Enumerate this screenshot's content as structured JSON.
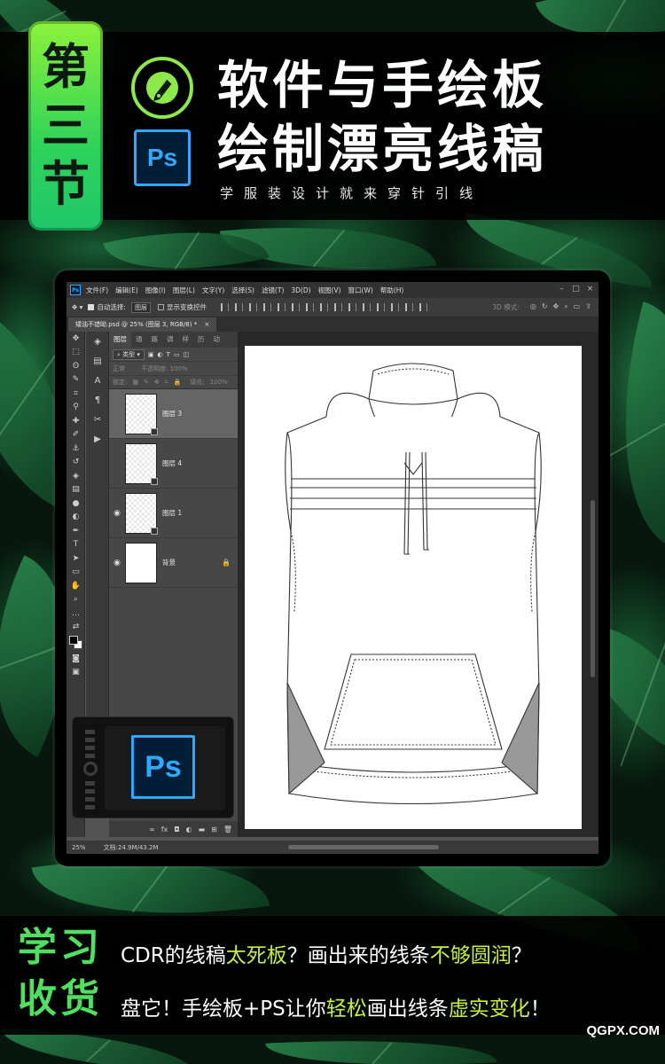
{
  "colors": {
    "accent_green": "#4fe05f",
    "highlight_yellow": "#c6f03a",
    "ps_blue": "#31a8ff",
    "ps_dark": "#001e36"
  },
  "badge": {
    "chars": [
      "第",
      "三",
      "节"
    ]
  },
  "header": {
    "title_line1": "软件与手绘板",
    "title_line2": "绘制漂亮线稿",
    "subtitle": "学服装设计就来穿针引线",
    "cdr_icon": "coreldraw-pen-icon",
    "ps_logo": "Ps"
  },
  "ps": {
    "menu": [
      "文件(F)",
      "编辑(E)",
      "图像(I)",
      "图层(L)",
      "文字(Y)",
      "选择(S)",
      "滤镜(T)",
      "3D(D)",
      "视图(V)",
      "窗口(W)",
      "帮助(H)"
    ],
    "options": {
      "auto_select": "自动选择:",
      "auto_select_value": "图层",
      "show_transform": "显示变换控件",
      "mode_3d": "3D 模式:"
    },
    "doc_tab": "矮油不错呦.psd @ 25% (图层 3, RGB/8) *",
    "panel_tabs": [
      "图层",
      "通",
      "路",
      "调",
      "样",
      "历",
      "动"
    ],
    "filter_label": "类型",
    "blend_mode": "正常",
    "opacity_label": "不透明度:",
    "opacity_value": "100%",
    "lock_label": "锁定:",
    "fill_label": "填充:",
    "fill_value": "100%",
    "layers": [
      {
        "name": "图层 3",
        "visible": false,
        "selected": true
      },
      {
        "name": "图层 4",
        "visible": false,
        "selected": false
      },
      {
        "name": "图层 1",
        "visible": true,
        "selected": false
      },
      {
        "name": "背景",
        "visible": true,
        "selected": false,
        "locked": true
      }
    ],
    "status": {
      "zoom": "25%",
      "doc_size": "文档:24.9M/43.2M"
    }
  },
  "tablet": {
    "ps_logo": "Ps"
  },
  "bottom": {
    "label_line1": "学习",
    "label_line2": "收货",
    "line1": {
      "pre": "CDR的线稿",
      "hl1": "太死板",
      "mid": "？画出来的线条",
      "hl2": "不够圆润",
      "post": "？"
    },
    "line2": {
      "pre": "盘它！手绘板+PS让你",
      "hl1": "轻松",
      "mid": "画出线条",
      "hl2": "虚实变化",
      "post": "！"
    }
  },
  "watermark": "QGPX.COM"
}
